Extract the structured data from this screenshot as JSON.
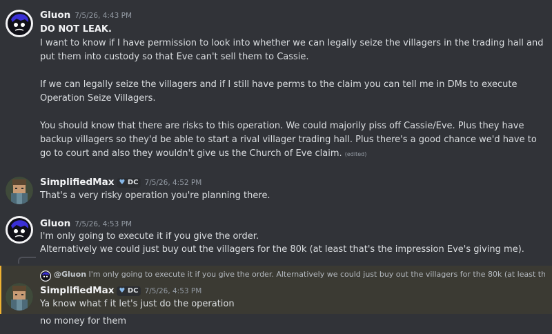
{
  "messages": [
    {
      "username": "Gluon",
      "timestamp": "7/5/26, 4:43 PM",
      "lines_bold": "DO NOT LEAK.",
      "para1": "I want to know if I have permission to look into whether we can legally seize the villagers in the trading hall and put them into custody so that Eve can't sell them to Cassie.",
      "para2": "If we can legally seize the villagers and if I still have perms to the claim you can tell me in DMs to execute Operation Seize Villagers.",
      "para3": "You should know that there are risks to this operation. We could majorily piss off Cassie/Eve. Plus they have backup villagers so they'd be able to start a rival villager trading hall. Plus there's a good chance we'd have to go to court and also they wouldn't give us the Church of Eve claim.",
      "edited": "(edited)"
    },
    {
      "username": "SimplifiedMax",
      "badge": "DC",
      "timestamp": "7/5/26, 4:52 PM",
      "text": "That's a very risky operation you're planning there."
    },
    {
      "username": "Gluon",
      "timestamp": "7/5/26, 4:53 PM",
      "line1": "I'm only going to execute it if you give the order.",
      "line2": "Alternatively we could just buy out the villagers for the 80k (at least that's the impression Eve's giving me)."
    },
    {
      "reply_to": "@Gluon",
      "reply_preview": "I'm only going to execute it if you give the order. Alternatively we could just buy out the villagers for the 80k (at least that'...",
      "username": "SimplifiedMax",
      "badge": "DC",
      "timestamp": "7/5/26, 4:53 PM",
      "text": "Ya know what f it let's just do the operation",
      "followup": "no money for them"
    }
  ],
  "icons": {
    "gluon_avatar": "gluon-avatar-icon",
    "max_avatar": "minecraft-avatar-icon",
    "badge_heart": "heart-icon"
  },
  "colors": {
    "background": "#313338",
    "mention_highlight": "#3b3a33",
    "mention_bar": "#f0b232"
  }
}
